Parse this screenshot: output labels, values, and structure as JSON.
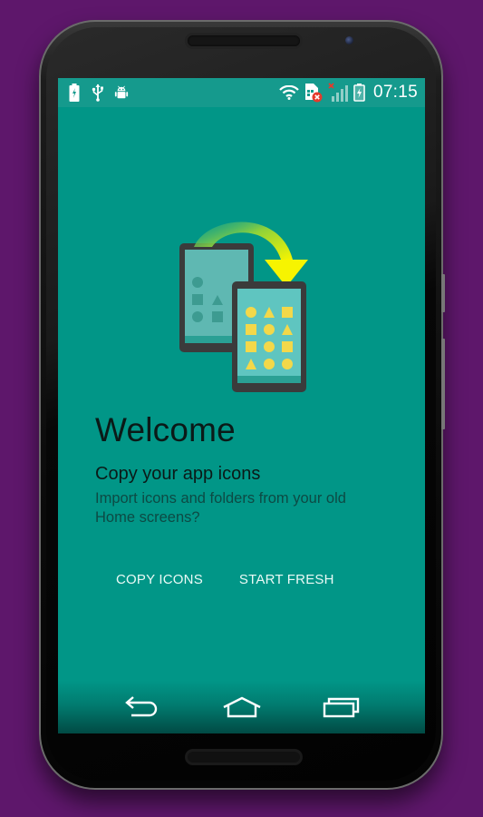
{
  "colors": {
    "background": "#5e176b",
    "screen": "#019687",
    "statusbar": "#159a8d",
    "accent_arrow": "#f5f000",
    "shape_yellow": "#f3d84a",
    "illegal_red": "#e53a2c"
  },
  "statusbar": {
    "left_icons": [
      "battery-charging-icon",
      "usb-icon",
      "android-debug-icon"
    ],
    "right_icons": [
      "wifi-icon",
      "sim-card-error-icon",
      "no-signal-icon",
      "battery-charging-icon"
    ],
    "time": "07:15"
  },
  "illustration": {
    "name": "copy-icons-illustration",
    "old_phone_shapes": [
      "circle",
      "square",
      "triangle",
      "circle",
      "square"
    ],
    "new_phone_shapes": [
      "circle",
      "triangle",
      "square",
      "square",
      "circle",
      "triangle",
      "square",
      "circle",
      "square",
      "triangle",
      "circle",
      "circle"
    ]
  },
  "content": {
    "title": "Welcome",
    "subtitle": "Copy your app icons",
    "description": "Import icons and folders from your old Home screens?"
  },
  "actions": {
    "copy_label": "COPY ICONS",
    "fresh_label": "START FRESH"
  },
  "navbar": {
    "back": "back-icon",
    "home": "home-icon",
    "recents": "recents-icon"
  }
}
